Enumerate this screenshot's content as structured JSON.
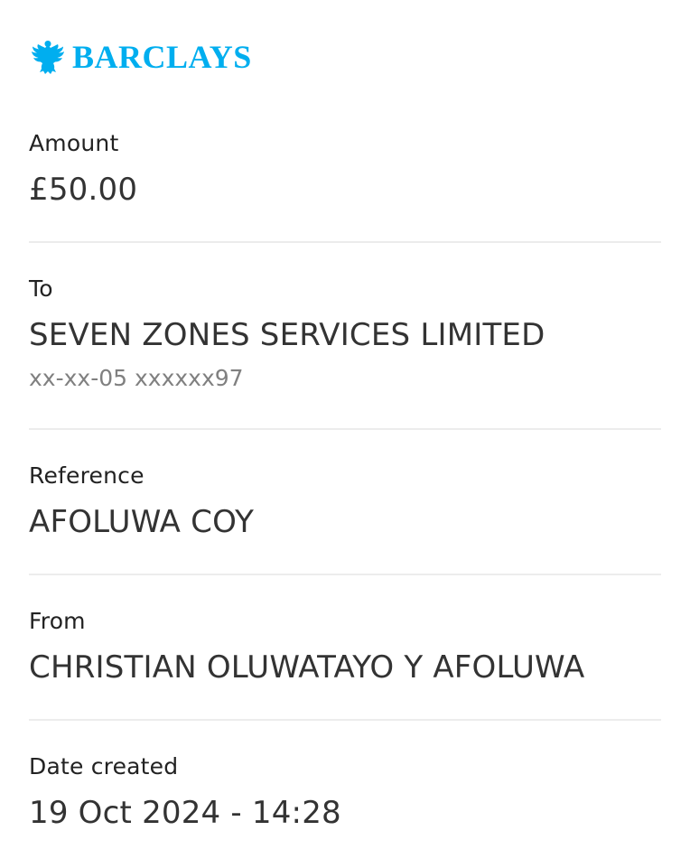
{
  "brand": {
    "name": "BARCLAYS",
    "color": "#00aeef",
    "icon": "eagle-icon"
  },
  "payment": {
    "amount": {
      "label": "Amount",
      "value": "£50.00"
    },
    "to": {
      "label": "To",
      "name": "SEVEN ZONES SERVICES LIMITED",
      "account": "xx-xx-05 xxxxxx97"
    },
    "reference": {
      "label": "Reference",
      "value": "AFOLUWA COY"
    },
    "from": {
      "label": "From",
      "value": "CHRISTIAN OLUWATAYO Y AFOLUWA"
    },
    "date_created": {
      "label": "Date created",
      "value": "19 Oct 2024 - 14:28"
    }
  }
}
